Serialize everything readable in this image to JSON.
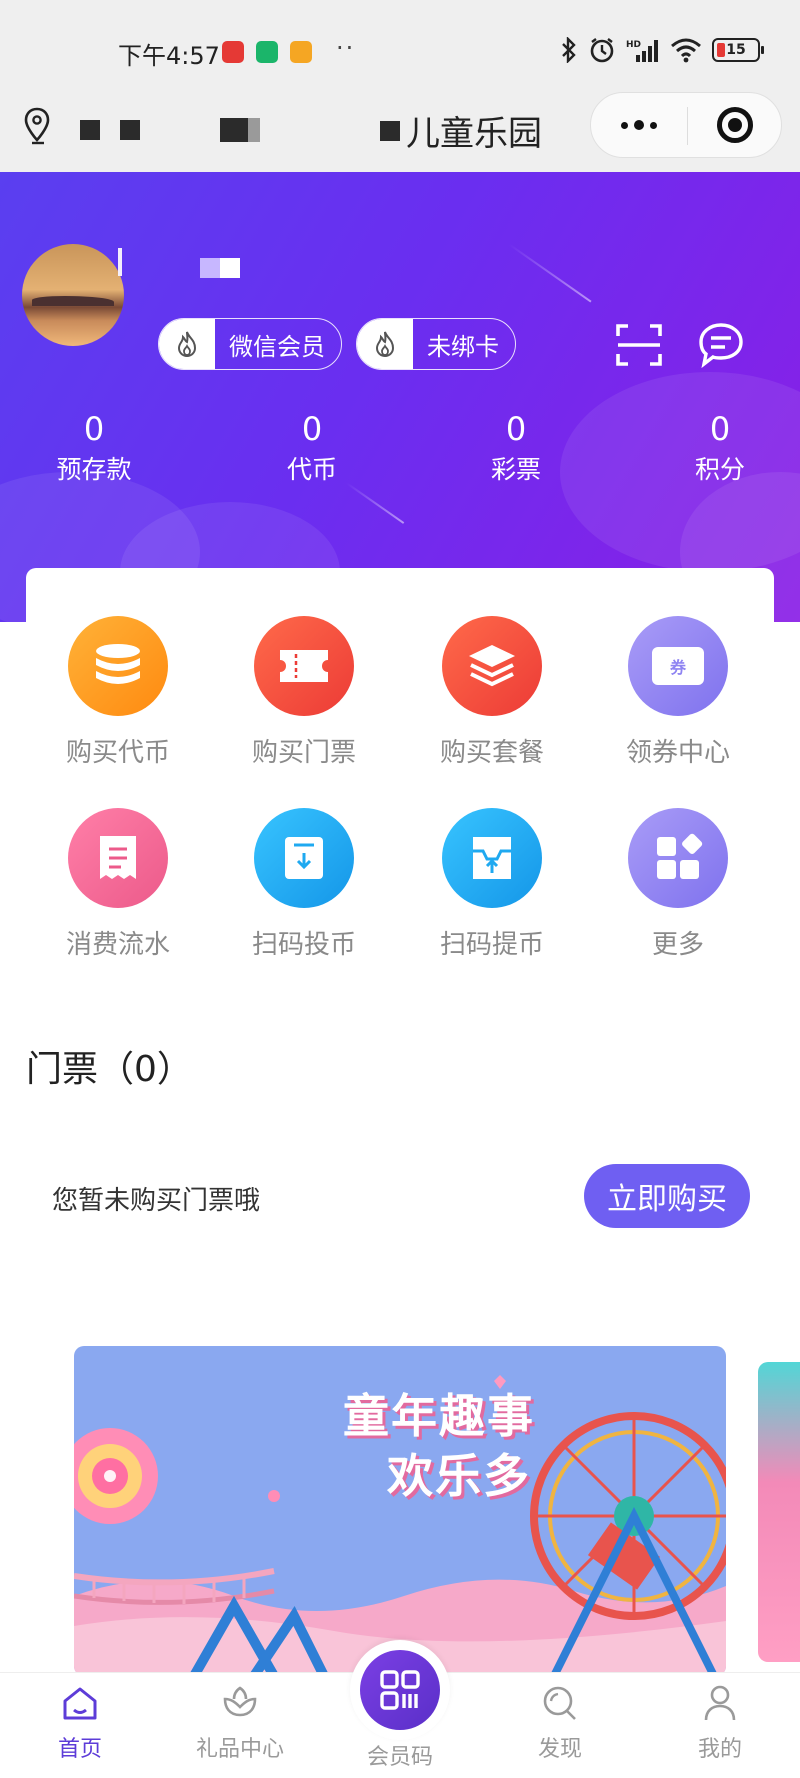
{
  "status_bar": {
    "time": "下午4:57",
    "battery": "15"
  },
  "nav": {
    "title": "儿童乐园"
  },
  "user": {
    "tags": [
      "微信会员",
      "未绑卡"
    ]
  },
  "stats": [
    {
      "value": "0",
      "label": "预存款"
    },
    {
      "value": "0",
      "label": "代币"
    },
    {
      "value": "0",
      "label": "彩票"
    },
    {
      "value": "0",
      "label": "积分"
    }
  ],
  "menu": [
    {
      "label": "购买代币",
      "icon": "coin-stack-icon",
      "color": "#ff9a18"
    },
    {
      "label": "购买门票",
      "icon": "ticket-icon",
      "color": "#f4473a"
    },
    {
      "label": "购买套餐",
      "icon": "layers-icon",
      "color": "#f4473a"
    },
    {
      "label": "领券中心",
      "icon": "coupon-icon",
      "color": "#8f84f2",
      "badge": "券"
    },
    {
      "label": "消费流水",
      "icon": "receipt-icon",
      "color": "#f06a96"
    },
    {
      "label": "扫码投币",
      "icon": "scan-insert-coin-icon",
      "color": "#1fa9f0"
    },
    {
      "label": "扫码提币",
      "icon": "scan-withdraw-coin-icon",
      "color": "#1fa9f0"
    },
    {
      "label": "更多",
      "icon": "grid-more-icon",
      "color": "#8f84f2"
    }
  ],
  "tickets": {
    "title": "门票（0）",
    "empty_text": "您暂未购买门票哦",
    "buy_label": "立即购买"
  },
  "banner": {
    "title_line1": "童年趣事",
    "title_line2": "欢乐多"
  },
  "tabs": [
    {
      "label": "首页",
      "icon": "home-icon",
      "active": true
    },
    {
      "label": "礼品中心",
      "icon": "gift-flower-icon",
      "active": false
    },
    {
      "label": "会员码",
      "icon": "qr-code-icon",
      "active": false
    },
    {
      "label": "发现",
      "icon": "search-icon",
      "active": false
    },
    {
      "label": "我的",
      "icon": "user-icon",
      "active": false
    }
  ],
  "colors": {
    "hero_start": "#5a3ff0",
    "hero_end": "#8a1fe6",
    "accent": "#6f5ff2",
    "tab_active": "#5d3cd8"
  }
}
